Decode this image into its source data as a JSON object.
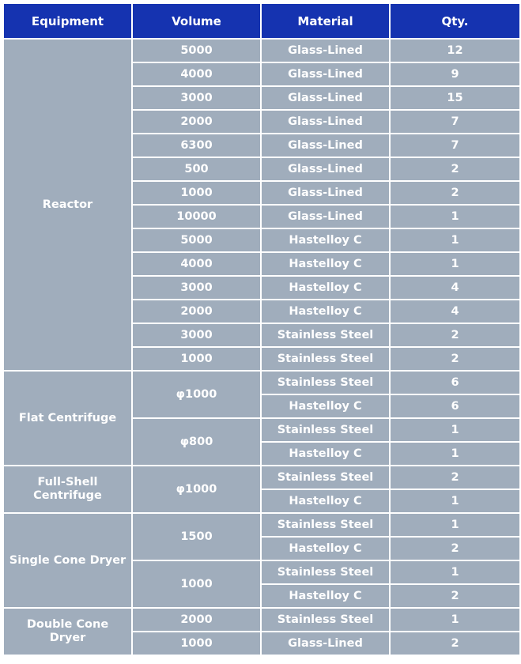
{
  "headers": [
    "Equipment",
    "Volume",
    "Material",
    "Qty."
  ],
  "colors": {
    "header_bg": "#1533b0",
    "cell_bg": "#a0adbc",
    "text": "#ffffff"
  },
  "groups": [
    {
      "equipment": "Reactor",
      "volumes": [
        {
          "volume": "5000",
          "items": [
            {
              "material": "Glass-Lined",
              "qty": "12"
            }
          ]
        },
        {
          "volume": "4000",
          "items": [
            {
              "material": "Glass-Lined",
              "qty": "9"
            }
          ]
        },
        {
          "volume": "3000",
          "items": [
            {
              "material": "Glass-Lined",
              "qty": "15"
            }
          ]
        },
        {
          "volume": "2000",
          "items": [
            {
              "material": "Glass-Lined",
              "qty": "7"
            }
          ]
        },
        {
          "volume": "6300",
          "items": [
            {
              "material": "Glass-Lined",
              "qty": "7"
            }
          ]
        },
        {
          "volume": "500",
          "items": [
            {
              "material": "Glass-Lined",
              "qty": "2"
            }
          ]
        },
        {
          "volume": "1000",
          "items": [
            {
              "material": "Glass-Lined",
              "qty": "2"
            }
          ]
        },
        {
          "volume": "10000",
          "items": [
            {
              "material": "Glass-Lined",
              "qty": "1"
            }
          ]
        },
        {
          "volume": "5000",
          "items": [
            {
              "material": "Hastelloy C",
              "qty": "1"
            }
          ]
        },
        {
          "volume": "4000",
          "items": [
            {
              "material": "Hastelloy C",
              "qty": "1"
            }
          ]
        },
        {
          "volume": "3000",
          "items": [
            {
              "material": "Hastelloy C",
              "qty": "4"
            }
          ]
        },
        {
          "volume": "2000",
          "items": [
            {
              "material": "Hastelloy C",
              "qty": "4"
            }
          ]
        },
        {
          "volume": "3000",
          "items": [
            {
              "material": "Stainless Steel",
              "qty": "2"
            }
          ]
        },
        {
          "volume": "1000",
          "items": [
            {
              "material": "Stainless Steel",
              "qty": "2"
            }
          ]
        }
      ]
    },
    {
      "equipment": "Flat Centrifuge",
      "volumes": [
        {
          "volume": "φ1000",
          "items": [
            {
              "material": "Stainless Steel",
              "qty": "6"
            },
            {
              "material": "Hastelloy C",
              "qty": "6"
            }
          ]
        },
        {
          "volume": "φ800",
          "items": [
            {
              "material": "Stainless Steel",
              "qty": "1"
            },
            {
              "material": "Hastelloy C",
              "qty": "1"
            }
          ]
        }
      ]
    },
    {
      "equipment": "Full-Shell Centrifuge",
      "volumes": [
        {
          "volume": "φ1000",
          "items": [
            {
              "material": "Stainless Steel",
              "qty": "2"
            },
            {
              "material": "Hastelloy C",
              "qty": "1"
            }
          ]
        }
      ]
    },
    {
      "equipment": "Single Cone Dryer",
      "volumes": [
        {
          "volume": "1500",
          "items": [
            {
              "material": "Stainless Steel",
              "qty": "1"
            },
            {
              "material": "Hastelloy C",
              "qty": "2"
            }
          ]
        },
        {
          "volume": "1000",
          "items": [
            {
              "material": "Stainless Steel",
              "qty": "1"
            },
            {
              "material": "Hastelloy C",
              "qty": "2"
            }
          ]
        }
      ]
    },
    {
      "equipment": "Double Cone Dryer",
      "volumes": [
        {
          "volume": "2000",
          "items": [
            {
              "material": "Stainless Steel",
              "qty": "1"
            }
          ]
        },
        {
          "volume": "1000",
          "items": [
            {
              "material": "Glass-Lined",
              "qty": "2"
            }
          ]
        }
      ]
    }
  ]
}
